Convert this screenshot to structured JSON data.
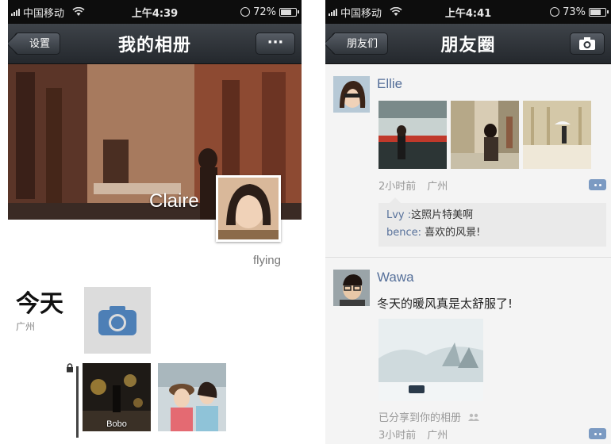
{
  "left_screen": {
    "status": {
      "carrier": "中国移动",
      "time": "上午4:39",
      "battery": "72%"
    },
    "nav": {
      "back_label": "设置",
      "title": "我的相册",
      "more_label": "···"
    },
    "cover": {
      "owner_name": "Claire",
      "signature": "flying"
    },
    "timeline": {
      "day_label": "今天",
      "location": "广州",
      "photos": [
        {
          "caption": "Bobo"
        },
        {
          "caption": ""
        }
      ]
    }
  },
  "right_screen": {
    "status": {
      "carrier": "中国移动",
      "time": "上午4:41",
      "battery": "73%"
    },
    "nav": {
      "back_label": "朋友们",
      "title": "朋友圈"
    },
    "posts": [
      {
        "user": "Ellie",
        "time_ago": "2小时前",
        "location": "广州",
        "comments": [
          {
            "name": "Lvy",
            "sep": " :",
            "text": "这照片特美啊"
          },
          {
            "name": "bence",
            "sep": ": ",
            "text": "喜欢的风景!"
          }
        ]
      },
      {
        "user": "Wawa",
        "text": "冬天的暖风真是太舒服了!",
        "share_note": "已分享到你的相册",
        "time_ago": "3小时前",
        "location": "广州"
      }
    ]
  },
  "colors": {
    "nav_dark": "#2f3439",
    "link_blue": "#56709a",
    "status_bg": "#0d0d0d"
  }
}
